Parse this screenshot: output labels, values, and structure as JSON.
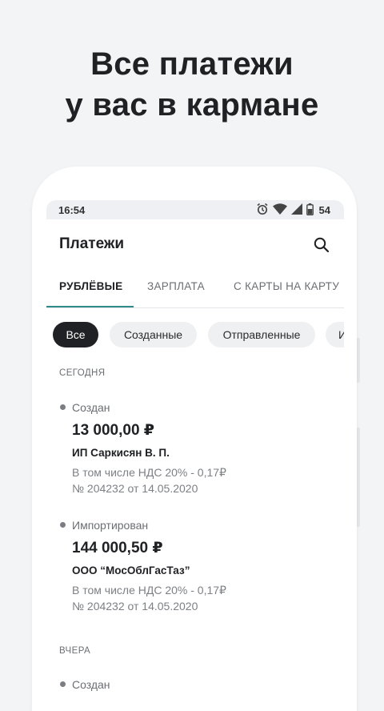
{
  "promo": {
    "line1": "Все платежи",
    "line2": "у вас в кармане"
  },
  "statusbar": {
    "time": "16:54",
    "battery": "54"
  },
  "appbar": {
    "title": "Платежи"
  },
  "tabs": [
    {
      "label": "РУБЛЁВЫЕ"
    },
    {
      "label": "ЗАРПЛАТА"
    },
    {
      "label": "С КАРТЫ НА КАРТУ"
    }
  ],
  "filters": [
    {
      "label": "Все"
    },
    {
      "label": "Созданные"
    },
    {
      "label": "Отправленные"
    },
    {
      "label": "И"
    }
  ],
  "sections": {
    "today": "СЕГОДНЯ",
    "yesterday": "ВЧЕРА"
  },
  "payments": [
    {
      "status": "Создан",
      "amount": "13 000,00 ₽",
      "payee": "ИП Саркисян В. П.",
      "vat": "В том числе НДС 20% - 0,17₽",
      "doc": "№ 204232 от 14.05.2020"
    },
    {
      "status": "Импортирован",
      "amount": "144 000,50 ₽",
      "payee": "ООО “МосОблГасТаз”",
      "vat": "В том числе НДС 20% - 0,17₽",
      "doc": "№ 204232 от 14.05.2020"
    },
    {
      "status": "Создан"
    }
  ],
  "colors": {
    "accent": "#2e8b8b",
    "chip_active": "#202124",
    "background": "#f3f4f6"
  },
  "icons": [
    "alarm-icon",
    "wifi-icon",
    "signal-icon",
    "battery-icon",
    "search-icon"
  ]
}
